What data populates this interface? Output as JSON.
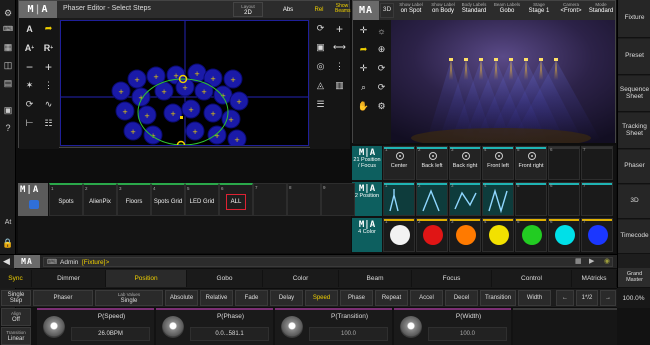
{
  "left_sidebar": {
    "icons": [
      "gear-icon",
      "keyboard-icon",
      "grid-icon",
      "windows-icon",
      "monitor-icon",
      "question-icon"
    ],
    "at_label": "At"
  },
  "phaser": {
    "title": "Phaser Editor - Select Steps",
    "header_buttons": [
      {
        "label": "Layout",
        "value": "2D"
      },
      {
        "label": "Abs",
        "value": ""
      },
      {
        "label": "Rel",
        "value": ""
      },
      {
        "label": "Show",
        "value": "Beams"
      }
    ],
    "tools_left": [
      "A",
      "arrow",
      "A+",
      "R+",
      "minus",
      "plus",
      "star",
      "dots",
      "rotate",
      "wave",
      "bracket",
      "split"
    ],
    "tools_right": [
      "refresh",
      "plus",
      "cube-swap",
      "arrows",
      "circles",
      "dots",
      "select",
      "layers"
    ],
    "selected_step_color": "#f0d000"
  },
  "viewer": {
    "title_btn": "3D",
    "header_buttons": [
      {
        "top": "Show Label",
        "bottom": "on Spot"
      },
      {
        "top": "Show Label",
        "bottom": "on Body"
      },
      {
        "top": "Body Labels",
        "bottom": "Standard"
      },
      {
        "top": "Beam Labels",
        "bottom": "Gobo"
      },
      {
        "top": "Stage",
        "bottom": "Stage 1"
      },
      {
        "top": "Camera",
        "bottom": "<Front>"
      },
      {
        "top": "Mode",
        "bottom": "Standard"
      }
    ]
  },
  "right_panel": {
    "buttons": [
      "Fixture",
      "Preset",
      "Sequence Sheet",
      "Tracking Sheet",
      "Phaser",
      "3D",
      "Timecode"
    ]
  },
  "presets": {
    "rows": [
      {
        "label": "21 Position / Focus",
        "cells": [
          {
            "num": "1",
            "name": "Center"
          },
          {
            "num": "2",
            "name": "Back left"
          },
          {
            "num": "3",
            "name": "Back right"
          },
          {
            "num": "4",
            "name": "Front left"
          },
          {
            "num": "5",
            "name": "Front right"
          },
          {
            "num": "6",
            "name": ""
          },
          {
            "num": "7",
            "name": ""
          }
        ]
      },
      {
        "label": "2 Position",
        "cells": [
          {
            "num": "1",
            "name": ""
          },
          {
            "num": "2",
            "name": ""
          },
          {
            "num": "3",
            "name": ""
          },
          {
            "num": "4",
            "name": ""
          },
          {
            "num": "5",
            "name": ""
          },
          {
            "num": "6",
            "name": ""
          },
          {
            "num": "7",
            "name": ""
          }
        ]
      },
      {
        "label": "4 Color",
        "cells": [
          {
            "num": "1",
            "color": "#f2f2f2"
          },
          {
            "num": "2",
            "color": "#e01515"
          },
          {
            "num": "3",
            "color": "#ff7a00"
          },
          {
            "num": "4",
            "color": "#f2e100"
          },
          {
            "num": "5",
            "color": "#22cc22"
          },
          {
            "num": "6",
            "color": "#00e0e8"
          },
          {
            "num": "7",
            "color": "#1b37ff"
          }
        ]
      }
    ]
  },
  "groups": {
    "cells": [
      {
        "num": "1",
        "name": "Spots"
      },
      {
        "num": "2",
        "name": "AlienPix"
      },
      {
        "num": "3",
        "name": "Floors"
      },
      {
        "num": "4",
        "name": "Spots Grid"
      },
      {
        "num": "5",
        "name": "LED Grid"
      },
      {
        "num": "6",
        "name": "ALL"
      },
      {
        "num": "7",
        "name": ""
      },
      {
        "num": "8",
        "name": ""
      },
      {
        "num": "9",
        "name": ""
      }
    ]
  },
  "command_line": {
    "user": "Admin",
    "text": "[Fixture]>"
  },
  "feature_bar": {
    "sync": "Sync",
    "items": [
      "Dimmer",
      "Position",
      "Gobo",
      "Color",
      "Beam",
      "Focus",
      "Control",
      "MAtricks"
    ],
    "active": "Position",
    "grand_master_label": "Grand Master",
    "grand_master_value": "100.0%"
  },
  "attribute_row": {
    "step_mode": {
      "top": "Single",
      "bottom": "Step"
    },
    "phaser_btn": "Phaser",
    "edit_mode": {
      "top": "Lab Values",
      "bottom": "Single"
    },
    "buttons": [
      "Absolute",
      "Relative",
      "Fade",
      "Delay",
      "Speed",
      "Phase",
      "Repeat",
      "Accel",
      "Decel",
      "Transition",
      "Width"
    ],
    "active": "Speed",
    "page": "1*/2"
  },
  "encoder_row": {
    "align": {
      "top": "Align",
      "bottom": "Off"
    },
    "transition": {
      "top": "Transition",
      "bottom": "Linear"
    },
    "encoders": [
      {
        "label": "P(Speed)",
        "value": "26.0BPM"
      },
      {
        "label": "P(Phase)",
        "value": "0.0...581.1"
      },
      {
        "label": "P(Transition)",
        "value": "100.0"
      },
      {
        "label": "P(Width)",
        "value": "100.0"
      }
    ]
  }
}
